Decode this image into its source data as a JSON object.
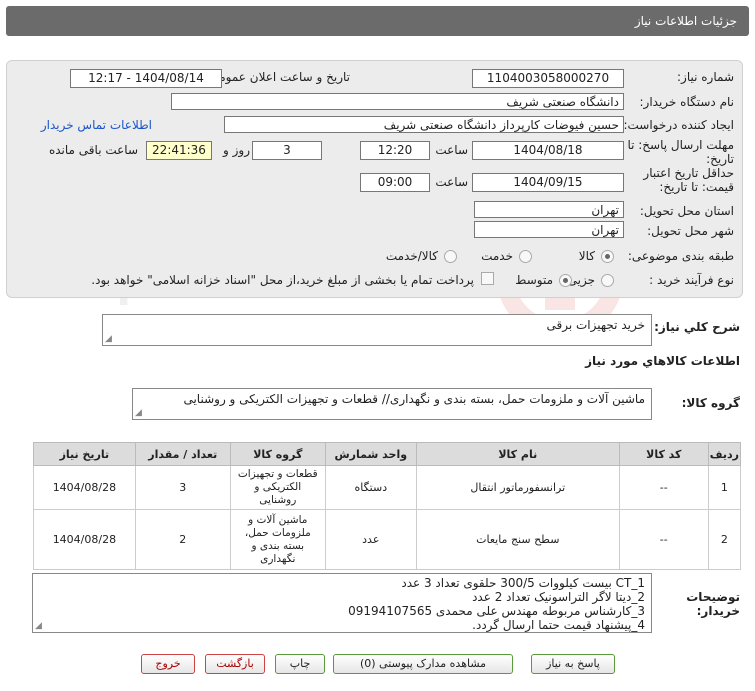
{
  "header": {
    "title": "جزئیات اطلاعات نیاز"
  },
  "form": {
    "need_number_label": "شماره نیاز:",
    "need_number": "1104003058000270",
    "announce_label": "تاریخ و ساعت اعلان عمومی:",
    "announce_value": "1404/08/14 - 12:17",
    "buyer_org_label": "نام دستگاه خریدار:",
    "buyer_org": "دانشگاه صنعتی شریف",
    "creator_label": "ایجاد کننده درخواست:",
    "creator": "حسین فیوضات کارپرداز دانشگاه صنعتی شریف",
    "contact_link": "اطلاعات تماس خریدار",
    "reply_deadline_label": "مهلت ارسال پاسخ: تا",
    "reply_deadline_label2": "تاریخ:",
    "reply_date": "1404/08/18",
    "time_label": "ساعت",
    "reply_time": "12:20",
    "days": "3",
    "days_label": "روز و",
    "remaining_time": "22:41:36",
    "remaining_label": "ساعت باقی مانده",
    "min_validity_label": "حداقل تاریخ اعتبار",
    "min_validity_label2": "قیمت: تا تاریخ:",
    "validity_date": "1404/09/15",
    "validity_time": "09:00",
    "province_label": "استان محل تحویل:",
    "province": "تهران",
    "city_label": "شهر محل تحویل:",
    "city": "تهران",
    "category_label": "طبقه بندی موضوعی:",
    "category_options": [
      "کالا",
      "خدمت",
      "کالا/خدمت"
    ],
    "purchase_type_label": "نوع فرآیند خرید :",
    "purchase_options": [
      "جزیی",
      "متوسط"
    ],
    "payment_note": "پرداخت تمام یا بخشی از مبلغ خرید،از محل \"اسناد خزانه اسلامی\" خواهد بود."
  },
  "summary": {
    "label": "شرح کلي نیاز:",
    "value": "خرید تجهیزات برقی"
  },
  "goods_info_title": "اطلاعات کالاهاي مورد نياز",
  "goods_group": {
    "label": "گروه کالا:",
    "value": "ماشین آلات و ملزومات حمل، بسته بندی و نگهداری// قطعات و تجهیزات الکتریکی و روشنایی"
  },
  "table": {
    "headers": [
      "ردیف",
      "کد کالا",
      "نام کالا",
      "واحد شمارش",
      "گروه کالا",
      "تعداد / مقدار",
      "تاریخ نیاز"
    ],
    "rows": [
      {
        "index": "1",
        "code": "--",
        "name": "ترانسفورماتور انتقال",
        "unit": "دستگاه",
        "group": "قطعات و تجهیزات الکتریکی و روشنایی",
        "qty": "3",
        "date": "1404/08/28"
      },
      {
        "index": "2",
        "code": "--",
        "name": "سطح سنج مایعات",
        "unit": "عدد",
        "group": "ماشین آلات و ملزومات حمل، بسته بندی و نگهداری",
        "qty": "2",
        "date": "1404/08/28"
      }
    ]
  },
  "buyer_notes": {
    "label": "توضیحات",
    "label2": "خریدار:",
    "lines": [
      "1_CT بیست کیلووات 300/5 حلقوی تعداد 3 عدد",
      "2_دیتا لاگر التراسونیک تعداد 2 عدد",
      "3_کارشناس مربوطه مهندس علی محمدی 09194107565",
      "4_پیشنهاد قیمت حتما ارسال گردد."
    ]
  },
  "buttons": {
    "reply": "پاسخ به نیاز",
    "docs": "مشاهده مدارک پیوستی (0)",
    "print": "چاپ",
    "back": "بازگشت",
    "exit": "خروج"
  },
  "watermark": {
    "text": "AriaTender.net"
  },
  "colors": {
    "header_bg": "#6b6b6b",
    "panel_bg": "#ececec",
    "link": "#1a55c8",
    "highlight": "#ffffcc"
  }
}
